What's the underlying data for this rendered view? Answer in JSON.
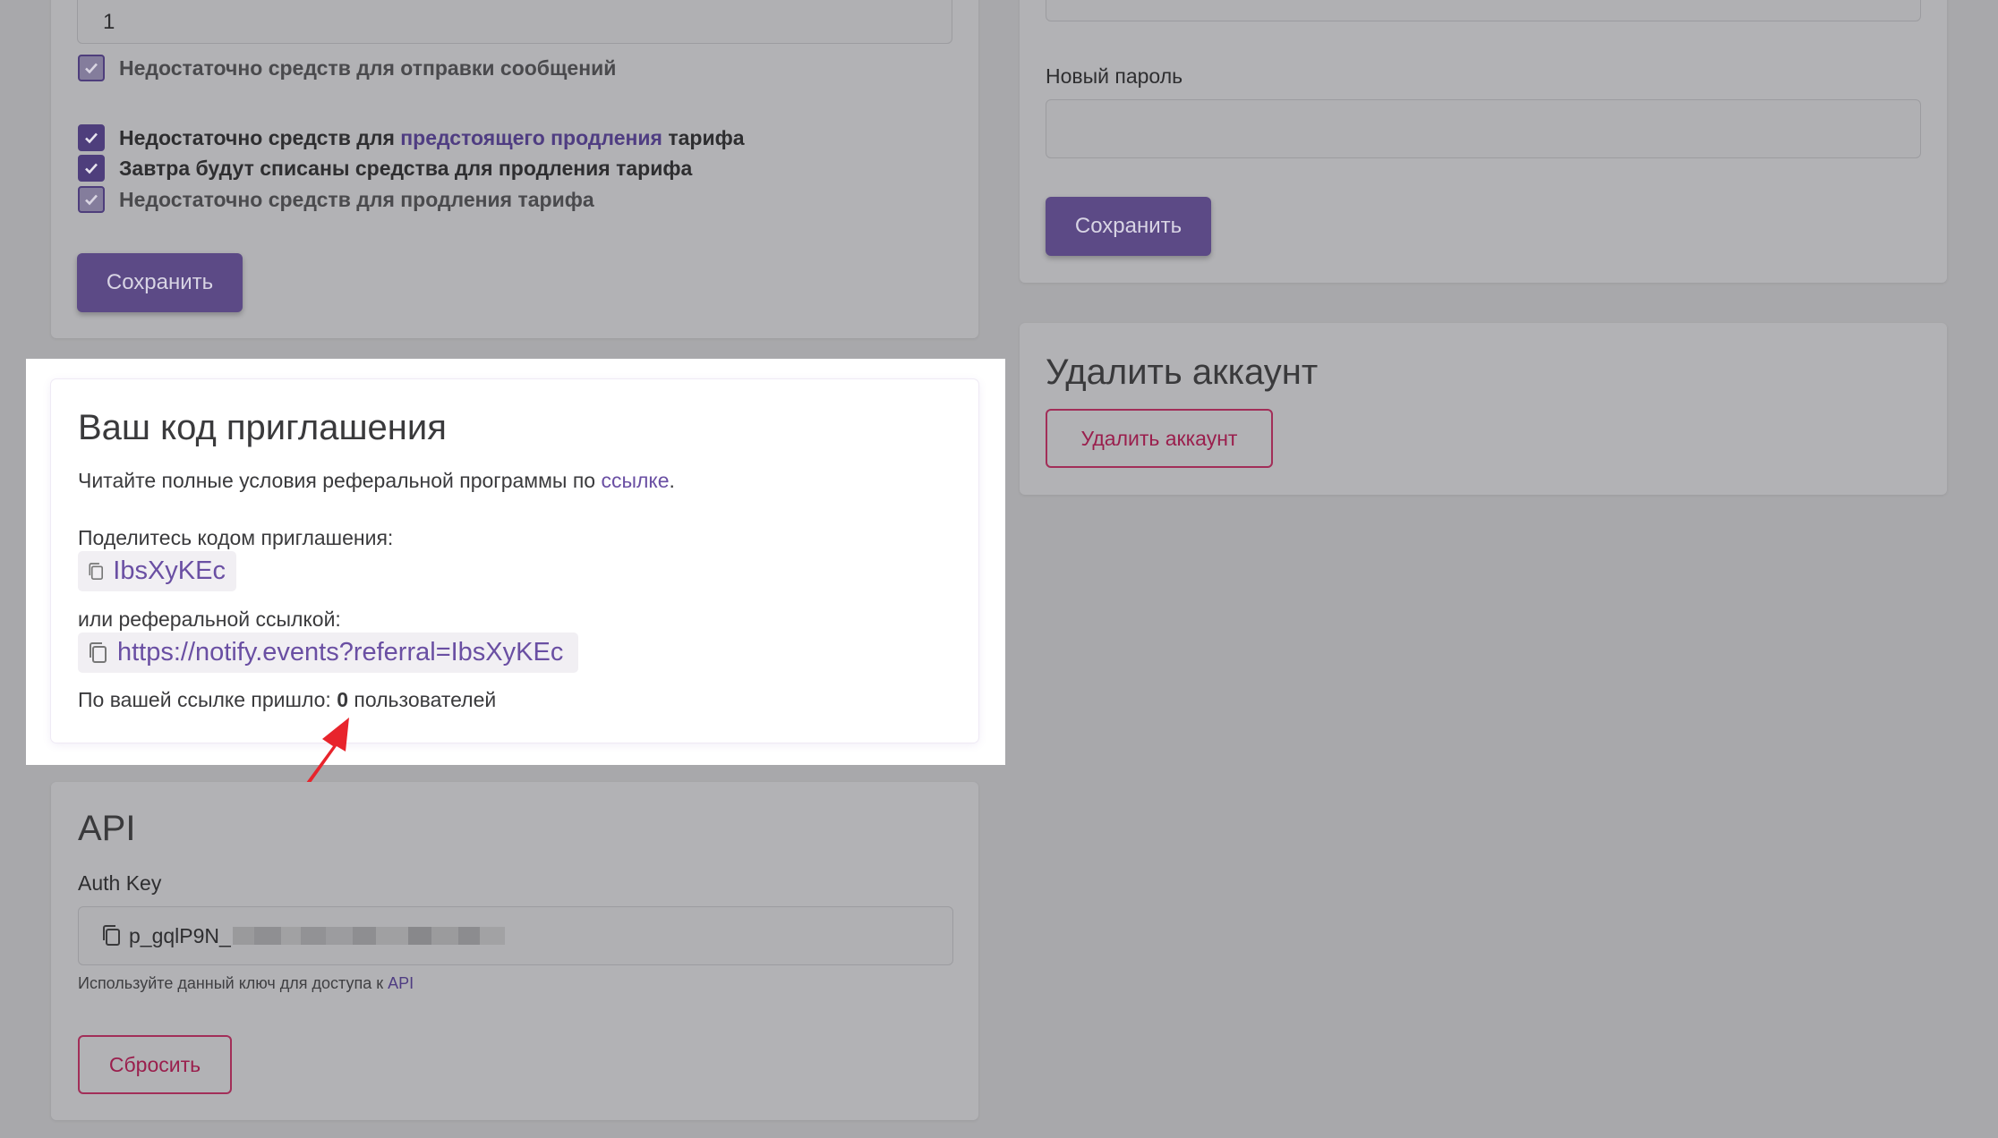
{
  "notifications": {
    "count_value": "1",
    "checkboxes": [
      {
        "text": "Недостаточно средств для отправки сообщений",
        "checked": true,
        "disabled": true
      },
      {
        "text_before": "Недостаточно средств для ",
        "link": "предстоящего продления",
        "text_after": " тарифа",
        "checked": true,
        "disabled": false
      },
      {
        "text": "Завтра будут списаны средства для продления тарифа",
        "checked": true,
        "disabled": false
      },
      {
        "text": "Недостаточно средств для продления тарифа",
        "checked": true,
        "disabled": true
      }
    ],
    "save_label": "Сохранить"
  },
  "password": {
    "new_password_label": "Новый пароль",
    "save_label": "Сохранить"
  },
  "delete_account": {
    "title": "Удалить аккаунт",
    "button_label": "Удалить аккаунт"
  },
  "invite": {
    "title": "Ваш код приглашения",
    "terms_text": "Читайте полные условия реферальной программы по ",
    "terms_link": "ссылке",
    "terms_end": ".",
    "share_code_label": "Поделитесь кодом приглашения:",
    "code": "IbsXyKEc",
    "or_link_label": "или реферальной ссылкой:",
    "referral_url": "https://notify.events?referral=IbsXyKEc",
    "stats_before": "По вашей ссылке пришло: ",
    "stats_count": "0",
    "stats_after": " пользователей"
  },
  "api": {
    "title": "API",
    "auth_key_label": "Auth Key",
    "auth_key_prefix": "p_gqlP9N_",
    "hint_text": "Используйте данный ключ для доступа к ",
    "hint_link": "API",
    "reset_label": "Сбросить"
  },
  "colors": {
    "accent": "#6a4fa3",
    "danger": "#c2185b",
    "annotation_arrow": "#e8242c"
  },
  "icons": {
    "copy": "copy-icon",
    "check": "check-icon"
  }
}
